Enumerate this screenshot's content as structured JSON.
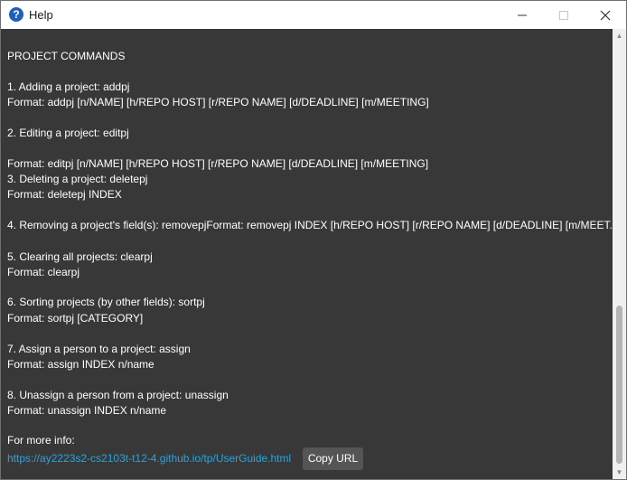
{
  "window": {
    "title": "Help",
    "app_icon_glyph": "?",
    "icon": "help-icon",
    "controls": [
      "minimize-icon",
      "maximize-icon",
      "close-icon"
    ]
  },
  "lines": [
    "PROJECT COMMANDS",
    "1. Adding a project: addpj",
    "Format: addpj [n/NAME] [h/REPO HOST] [r/REPO NAME] [d/DEADLINE] [m/MEETING]",
    "2. Editing a project: editpj",
    "Format: editpj [n/NAME] [h/REPO HOST] [r/REPO NAME] [d/DEADLINE] [m/MEETING]",
    "3. Deleting a project: deletepj",
    "Format: deletepj INDEX",
    "4. Removing a project's field(s): removepjFormat: removepj INDEX [h/REPO HOST] [r/REPO NAME] [d/DEADLINE] [m/MEET...",
    "5. Clearing all projects: clearpj",
    "Format: clearpj",
    "6. Sorting projects (by other fields): sortpj",
    "Format: sortpj [CATEGORY]",
    "7. Assign a person to a project: assign",
    "Format: assign INDEX n/name",
    "8. Unassign a person from a project: unassign",
    "Format: unassign INDEX n/name",
    "For more info:"
  ],
  "url": "https://ay2223s2-cs2103t-t12-4.github.io/tp/UserGuide.html",
  "copy_button": "Copy URL",
  "colors": {
    "background": "#383838",
    "text": "#ffffff",
    "link": "#2aa3dc",
    "button": "#555555"
  }
}
